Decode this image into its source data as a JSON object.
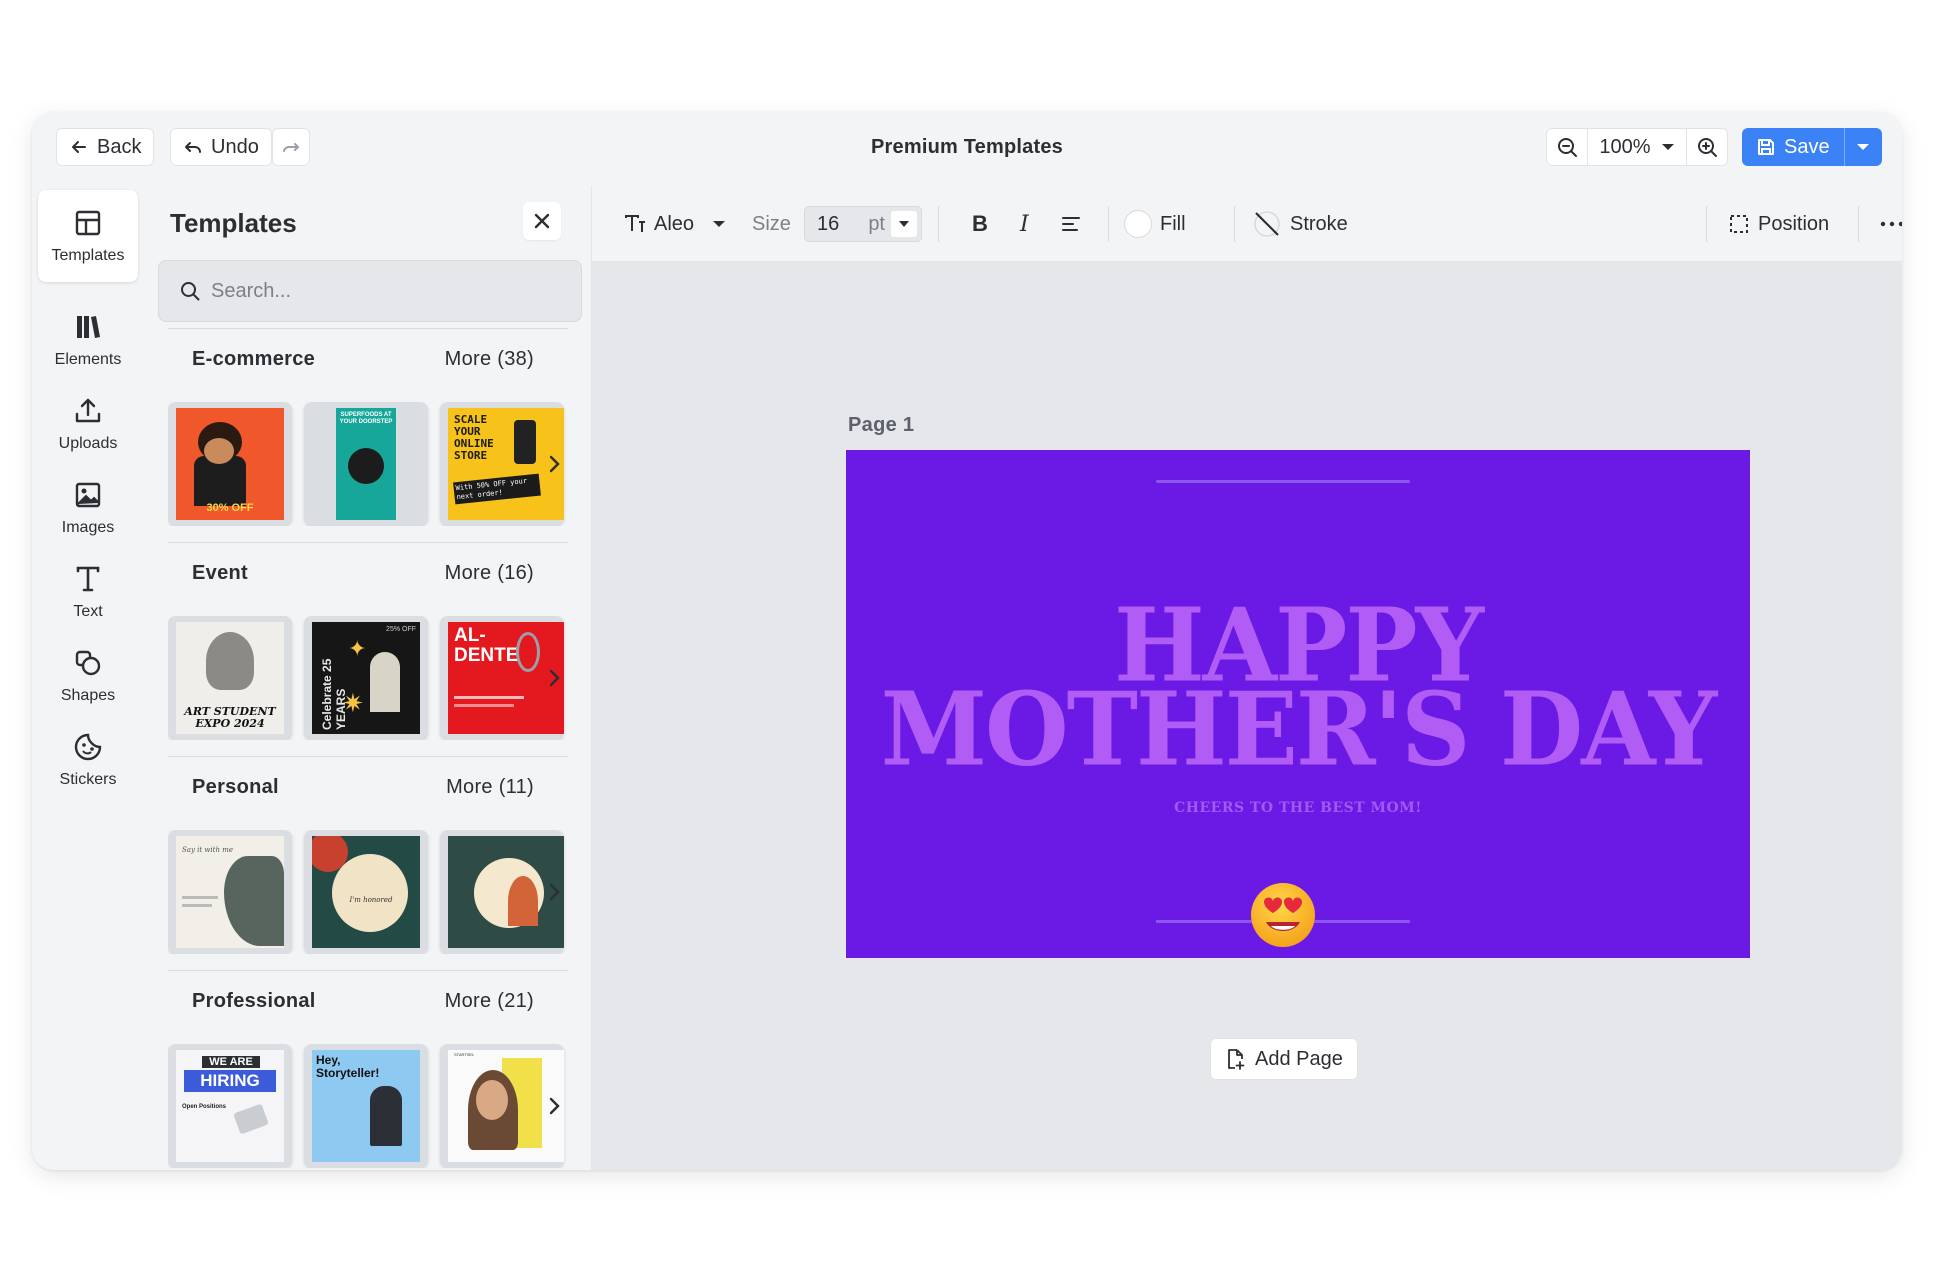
{
  "topbar": {
    "back_label": "Back",
    "undo_label": "Undo",
    "title": "Premium Templates",
    "zoom": "100%",
    "save_label": "Save",
    "accent_color": "#3b82f6"
  },
  "rail": {
    "items": [
      {
        "label": "Templates",
        "icon": "layout-icon",
        "active": true
      },
      {
        "label": "Elements",
        "icon": "library-icon"
      },
      {
        "label": "Uploads",
        "icon": "upload-icon"
      },
      {
        "label": "Images",
        "icon": "image-icon"
      },
      {
        "label": "Text",
        "icon": "text-icon"
      },
      {
        "label": "Shapes",
        "icon": "shapes-icon"
      },
      {
        "label": "Stickers",
        "icon": "sticker-icon"
      }
    ]
  },
  "panel": {
    "title": "Templates",
    "search_placeholder": "Search...",
    "sections": [
      {
        "name": "E-commerce",
        "more": "More (38)",
        "thumbs": [
          {
            "text": "30% OFF"
          },
          {
            "text": "SUPERFOODS AT YOUR DOORSTEP"
          },
          {
            "text": "SCALE YOUR ONLINE STORE",
            "text2": "With 50% OFF your next order!"
          }
        ]
      },
      {
        "name": "Event",
        "more": "More (16)",
        "thumbs": [
          {
            "text": "ART STUDENT EXPO 2024"
          },
          {
            "text": "Celebrate 25 YEARS",
            "text2": "25% OFF"
          },
          {
            "text": "AL- DENTE"
          }
        ]
      },
      {
        "name": "Personal",
        "more": "More (11)",
        "thumbs": [
          {
            "text": "Say it with me"
          },
          {
            "text": "I'm honored"
          },
          {
            "text": ""
          }
        ]
      },
      {
        "name": "Professional",
        "more": "More (21)",
        "thumbs": [
          {
            "text": "WE ARE",
            "text2": "HIRING",
            "text3": "Open Positions"
          },
          {
            "text": "Hey, Storyteller!"
          },
          {
            "text": "STARTSEL"
          }
        ]
      }
    ]
  },
  "toolbar": {
    "font": "Aleo",
    "size_label": "Size",
    "size_value": "16",
    "size_unit": "pt",
    "bold": "B",
    "italic": "I",
    "fill_label": "Fill",
    "stroke_label": "Stroke",
    "position_label": "Position"
  },
  "canvas": {
    "page_label": "Page  1",
    "design": {
      "background": "#6b1ae6",
      "headline_line1": "HAPPY",
      "headline_line2": "MOTHER'S DAY",
      "subtitle": "CHEERS TO THE BEST MOM!",
      "emoji": "heart-eyes-emoji"
    },
    "add_page_label": "Add Page"
  }
}
